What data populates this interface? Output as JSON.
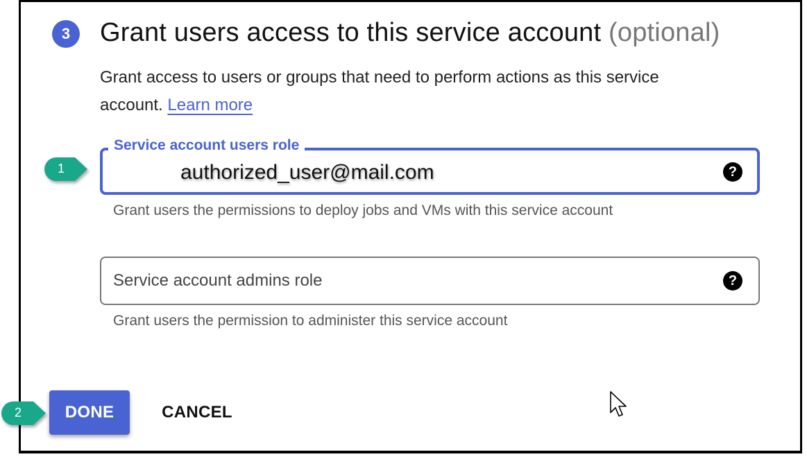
{
  "step": {
    "number": "3",
    "title": "Grant users access to this service account",
    "title_optional": "(optional)",
    "description": "Grant access to users or groups that need to perform actions as this service account.",
    "learn_more_label": "Learn more"
  },
  "users_role_field": {
    "label": "Service account users role",
    "value": "authorized_user@mail.com",
    "hint": "Grant users the permissions to deploy jobs and VMs with this service account",
    "help_icon": "?"
  },
  "admins_role_field": {
    "placeholder": "Service account admins role",
    "hint": "Grant users the permission to administer this service account",
    "help_icon": "?"
  },
  "buttons": {
    "done_label": "DONE",
    "cancel_label": "CANCEL"
  },
  "callouts": {
    "first": "1",
    "second": "2"
  },
  "colors": {
    "accent": "#4a63d3",
    "callout": "#1aa88a"
  }
}
